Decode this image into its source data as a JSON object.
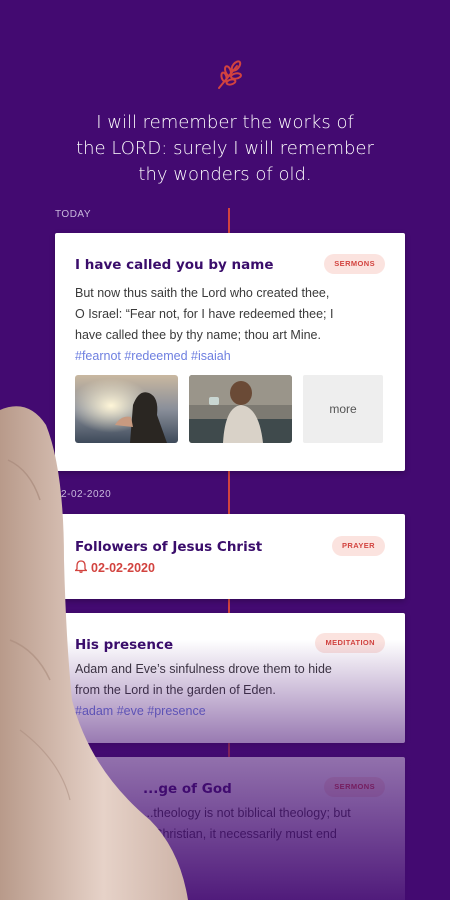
{
  "header": {
    "logo_icon": "wheat-sprig-icon",
    "verse_line1": "I will remember the works of",
    "verse_line2": "the LORD: surely I will remember",
    "verse_line3": "thy wonders of old."
  },
  "colors": {
    "background": "#430a71",
    "accent": "#d2433f",
    "title": "#3a0d6b",
    "hashtag": "#6e7fe0"
  },
  "timeline": [
    {
      "date_label": "TODAY",
      "title": "I have called you by name",
      "tag": "SERMONS",
      "body_line1": "But now thus saith the Lord who created thee,",
      "body_line2": "O Israel: “Fear not, for I have redeemed thee; I",
      "body_line3": "have called thee by thy name; thou art Mine.",
      "hashtags": "#fearnot #redeemed #isaiah",
      "more_label": "more"
    },
    {
      "date_label": "02-02-2020",
      "title": "Followers of Jesus Christ",
      "tag": "PRAYER",
      "reminder_icon": "bell-icon",
      "reminder_date": "02-02-2020"
    },
    {
      "title": "His presence",
      "tag": "MEDITATION",
      "body_line1": "Adam and Eve’s sinfulness drove them to hide",
      "body_line2": "from the Lord in the garden of Eden.",
      "hashtags": "#adam #eve #presence"
    },
    {
      "title": "...ge of God",
      "tag": "SERMONS",
      "body_line1": "...theology is not biblical theology; but",
      "body_line2": "...Christian, it necessarily must end"
    }
  ]
}
